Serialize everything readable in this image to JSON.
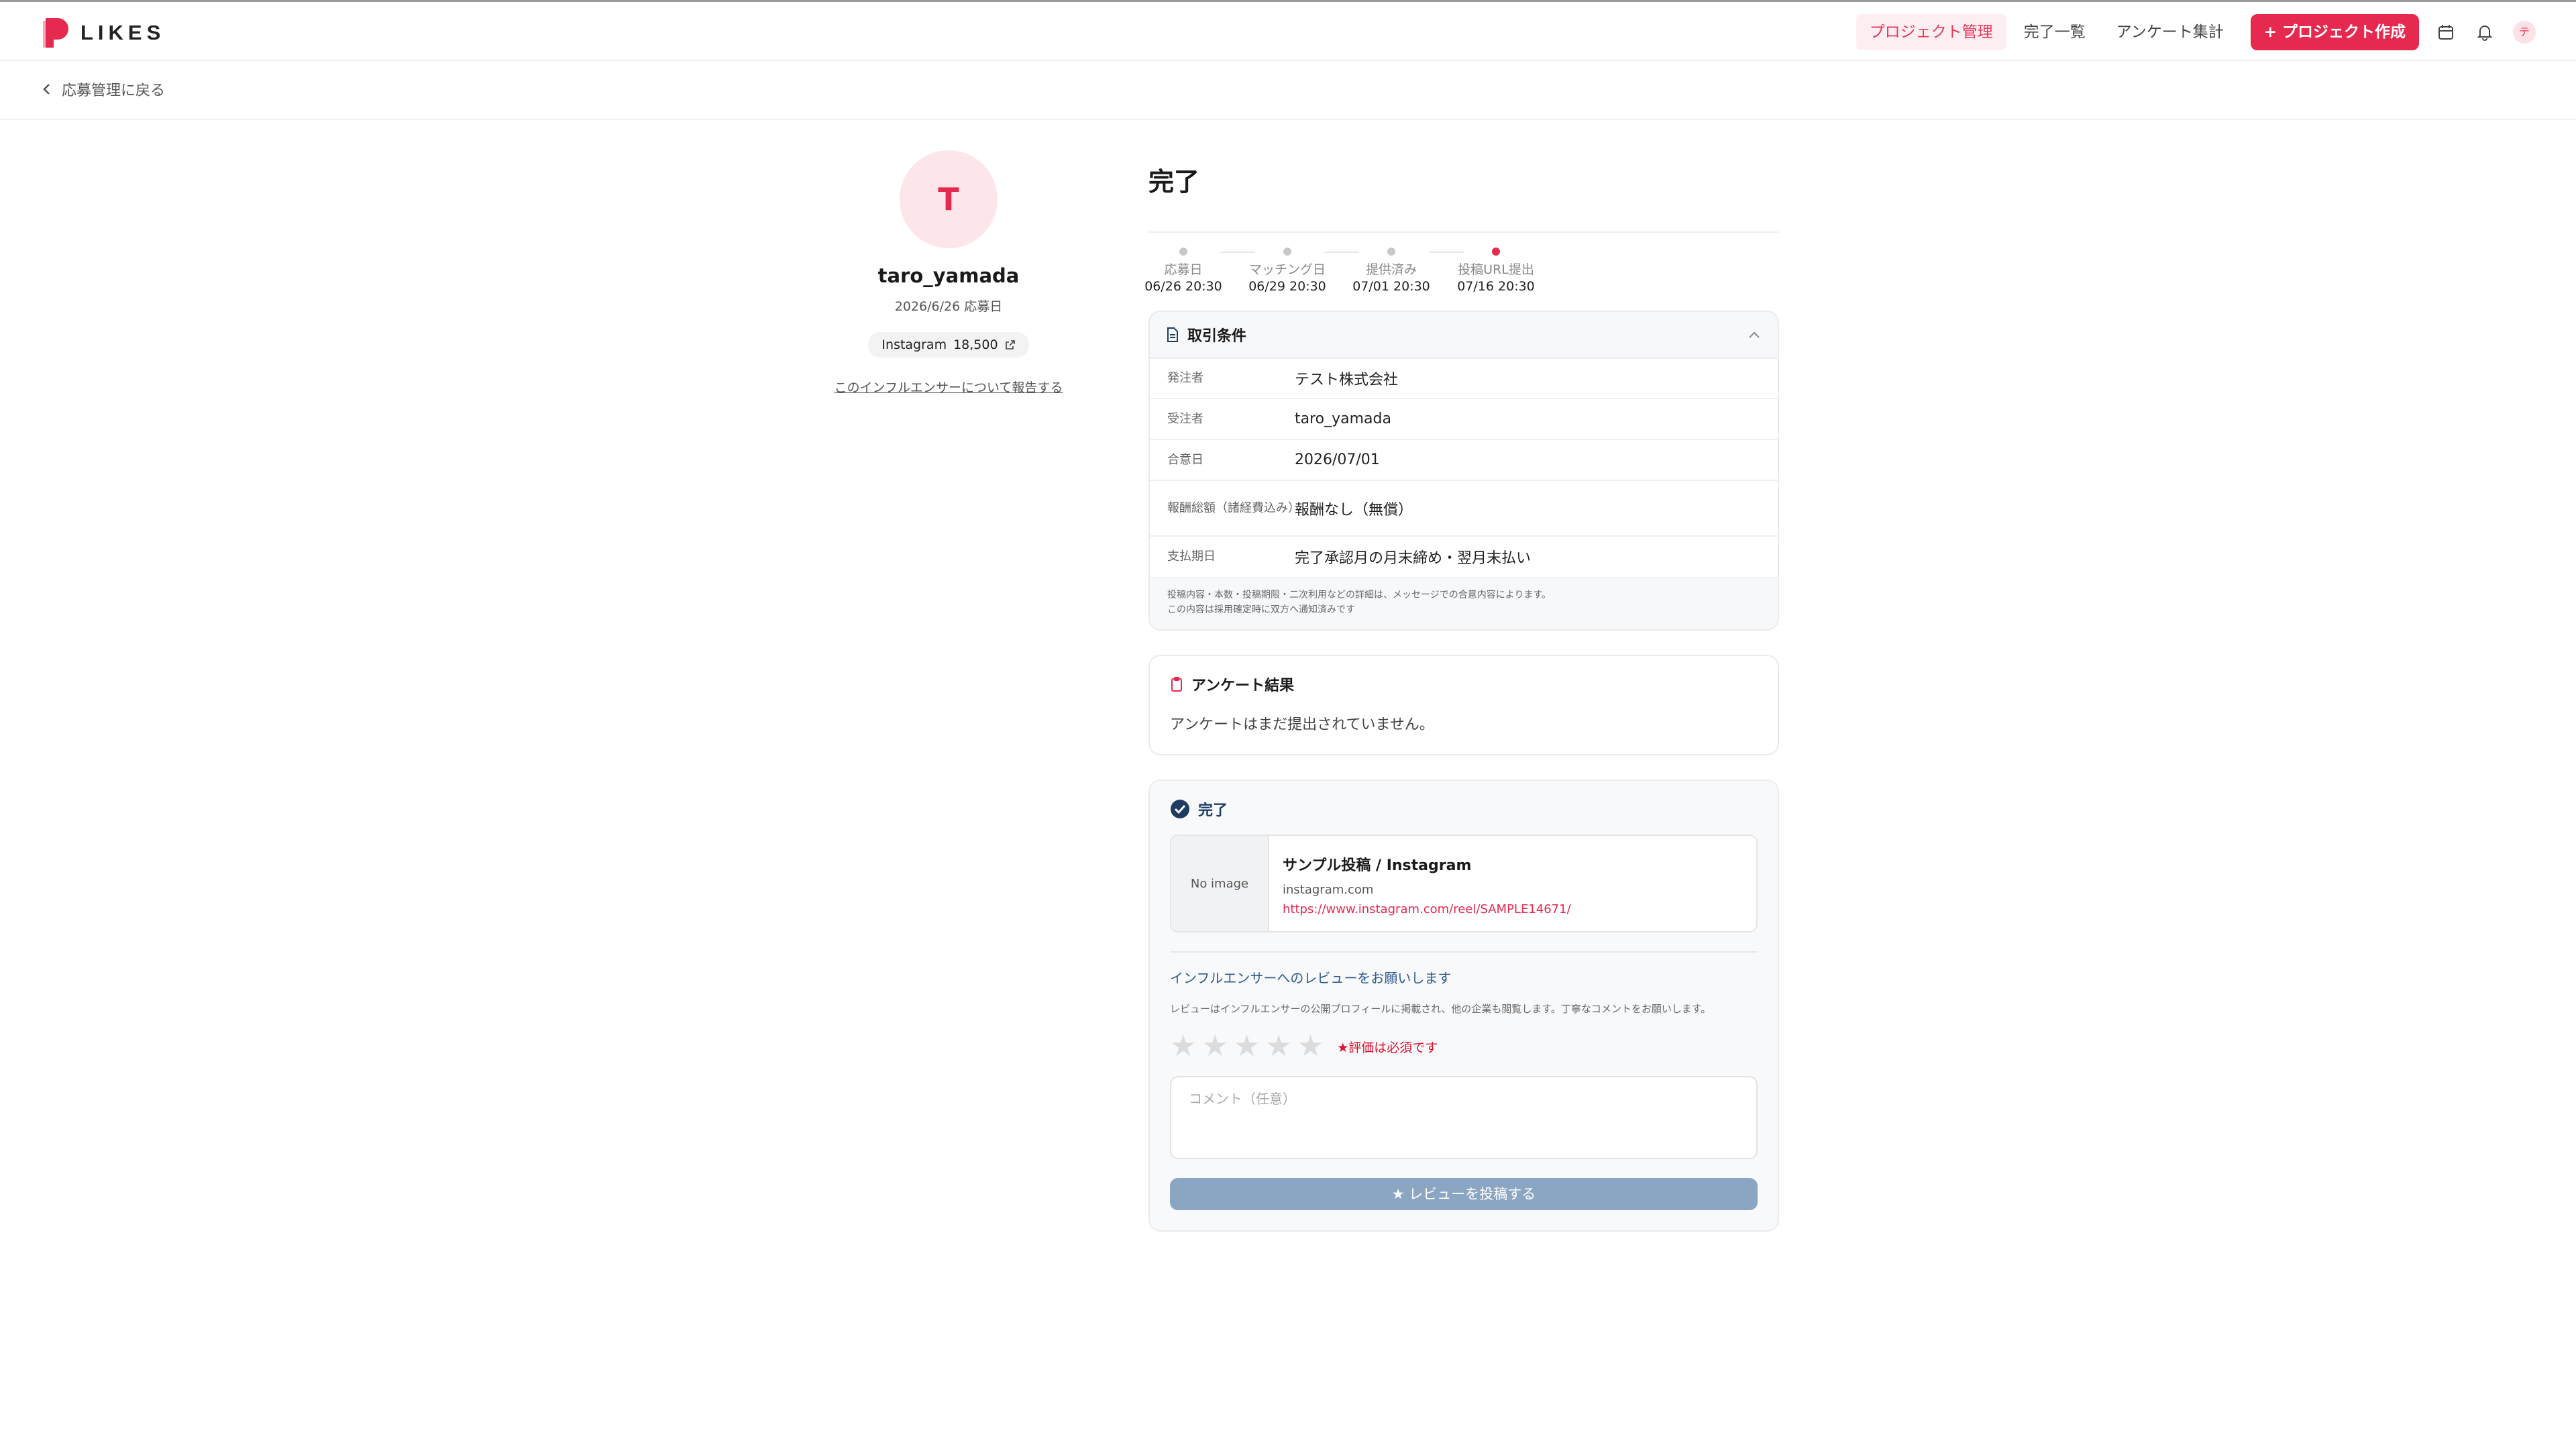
{
  "header": {
    "brand": "LIKES",
    "nav": [
      "プロジェクト管理",
      "完了一覧",
      "アンケート集計"
    ],
    "create_label": "+ プロジェクト作成",
    "avatar_initial": "テ",
    "accent_color": "#e6294f"
  },
  "back": {
    "label": "応募管理に戻る"
  },
  "profile": {
    "initial": "T",
    "username": "taro_yamada",
    "applied": "2026/6/26 応募日",
    "platform": "Instagram",
    "followers": "18,500",
    "report_link": "このインフルエンサーについて報告する"
  },
  "status": {
    "title": "完了"
  },
  "steps": [
    {
      "label": "応募日",
      "date": "06/26 20:30",
      "current": false
    },
    {
      "label": "マッチング日",
      "date": "06/29 20:30",
      "current": false
    },
    {
      "label": "提供済み",
      "date": "07/01 20:30",
      "current": false
    },
    {
      "label": "投稿URL提出",
      "date": "07/16 20:30",
      "current": true
    }
  ],
  "terms": {
    "title": "取引条件",
    "rows": [
      {
        "key": "発注者",
        "value": "テスト株式会社"
      },
      {
        "key": "受注者",
        "value": "taro_yamada"
      },
      {
        "key": "合意日",
        "value": "2026/07/01"
      },
      {
        "key": "報酬総額（諸経費込み）",
        "value": "報酬なし（無償）"
      },
      {
        "key": "支払期日",
        "value": "完了承認月の月末締め・翌月末払い"
      }
    ],
    "note1": "投稿内容・本数・投稿期限・二次利用などの詳細は、メッセージでの合意内容によります。",
    "note2": "この内容は採用確定時に双方へ通知済みです"
  },
  "survey": {
    "title": "アンケート結果",
    "body": "アンケートはまだ提出されていません。"
  },
  "completion": {
    "title": "完了",
    "no_image": "No image",
    "post_title": "サンプル投稿 / Instagram",
    "domain": "instagram.com",
    "url": "https://www.instagram.com/reel/SAMPLE14671/",
    "review_title": "インフルエンサーへのレビューをお願いします",
    "review_desc": "レビューはインフルエンサーの公開プロフィールに掲載され、他の企業も閲覧します。丁寧なコメントをお願いします。",
    "rating": 0,
    "rating_max": 5,
    "required": "★評価は必須です",
    "comment_placeholder": "コメント（任意）",
    "submit_label": "★ レビューを投稿する"
  }
}
